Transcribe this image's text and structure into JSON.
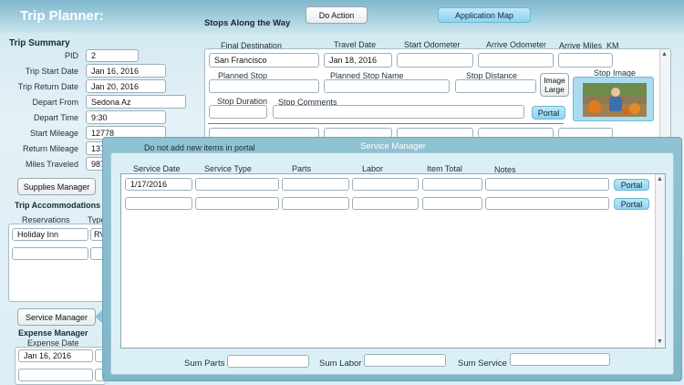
{
  "app": {
    "title": "Trip Planner:"
  },
  "toolbar": {
    "do_action": "Do Action",
    "application_map": "Application Map"
  },
  "stops": {
    "heading": "Stops Along the Way",
    "labels": {
      "final_destination": "Final Destination",
      "travel_date": "Travel Date",
      "start_odometer": "Start Odometer",
      "arrive_odometer": "Arrive Odometer",
      "arrive_miles_km": "Arrive Miles_KM",
      "planned_stop": "Planned Stop",
      "planned_stop_name": "Planned Stop Name",
      "stop_distance": "Stop Distance",
      "stop_image": "Stop Image",
      "stop_duration": "Stop Duration",
      "stop_comments": "Stop Comments"
    },
    "values": {
      "final_destination": "San Francisco",
      "travel_date": "Jan 18, 2016"
    },
    "image_large_button": "Image\nLarge",
    "portal_button": "Portal"
  },
  "summary": {
    "title": "Trip Summary",
    "fields": [
      {
        "label": "PID",
        "value": "2"
      },
      {
        "label": "Trip Start Date",
        "value": "Jan 16, 2016"
      },
      {
        "label": "Trip Return Date",
        "value": "Jan 20, 2016"
      },
      {
        "label": "Depart From",
        "value": "Sedona Az"
      },
      {
        "label": "Depart Time",
        "value": "9:30"
      },
      {
        "label": "Start Mileage",
        "value": "12778"
      },
      {
        "label": "Return Mileage",
        "value": "137"
      },
      {
        "label": "Miles Traveled",
        "value": "987"
      }
    ],
    "supplies_button": "Supplies Manager",
    "note": "Do not add new items in portal"
  },
  "accommodations": {
    "title": "Trip Accommodations",
    "col_reservations": "Reservations",
    "col_type": "Type",
    "rows": [
      {
        "reservation": "Holiday Inn",
        "type": "RV"
      },
      {
        "reservation": "",
        "type": ""
      }
    ]
  },
  "service_button": "Service Manager",
  "expense": {
    "title": "Expense Manager",
    "col_date": "Expense Date",
    "rows": [
      {
        "date": "Jan 16, 2016"
      },
      {
        "date": ""
      }
    ]
  },
  "service_manager": {
    "title": "Service Manager",
    "columns": [
      "Service Date",
      "Service Type",
      "Parts",
      "Labor",
      "Item Total",
      "Notes"
    ],
    "rows": [
      {
        "date": "1/17/2016",
        "type": "",
        "parts": "",
        "labor": "",
        "total": "",
        "notes": "",
        "portal": "Portal"
      },
      {
        "date": "",
        "type": "",
        "parts": "",
        "labor": "",
        "total": "",
        "notes": "",
        "portal": "Portal"
      }
    ],
    "sum_parts_label": "Sum Parts",
    "sum_labor_label": "Sum Labor",
    "sum_service_label": "Sum Service"
  }
}
